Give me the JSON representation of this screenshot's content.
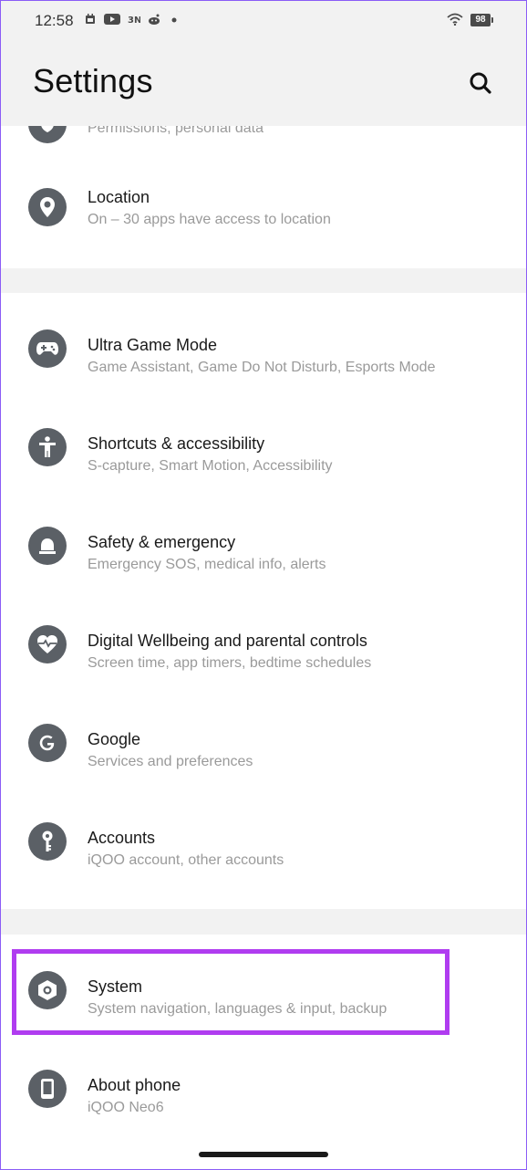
{
  "status_bar": {
    "time": "12:58",
    "notification_icons": [
      "calendar-icon",
      "youtube-icon",
      "news-icon",
      "reddit-icon",
      "dot-icon"
    ],
    "battery": "98",
    "wifi": "wifi-icon"
  },
  "header": {
    "title": "Settings",
    "search_icon": "search-icon"
  },
  "items": [
    {
      "title": "",
      "subtitle": "Permissions, personal data",
      "icon": "privacy-icon"
    },
    {
      "title": "Location",
      "subtitle": "On – 30 apps have access to location",
      "icon": "location-pin-icon"
    },
    {
      "title": "Ultra Game Mode",
      "subtitle": "Game Assistant, Game Do Not Disturb, Esports Mode",
      "icon": "gamepad-icon"
    },
    {
      "title": "Shortcuts & accessibility",
      "subtitle": "S-capture, Smart Motion, Accessibility",
      "icon": "accessibility-icon"
    },
    {
      "title": "Safety & emergency",
      "subtitle": "Emergency SOS, medical info, alerts",
      "icon": "emergency-light-icon"
    },
    {
      "title": "Digital Wellbeing and parental controls",
      "subtitle": "Screen time, app timers, bedtime schedules",
      "icon": "heart-pulse-icon"
    },
    {
      "title": "Google",
      "subtitle": "Services and preferences",
      "icon": "google-icon"
    },
    {
      "title": "Accounts",
      "subtitle": "iQOO account, other accounts",
      "icon": "key-icon"
    },
    {
      "title": "System",
      "subtitle": "System navigation, languages & input, backup",
      "icon": "gear-hexagon-icon"
    },
    {
      "title": "About phone",
      "subtitle": "iQOO Neo6",
      "icon": "phone-icon"
    }
  ],
  "colors": {
    "highlight": "#b03cf0",
    "icon_bg": "#5b6066",
    "subtitle": "#9a9a9a",
    "section_gap": "#f2f2f2"
  }
}
